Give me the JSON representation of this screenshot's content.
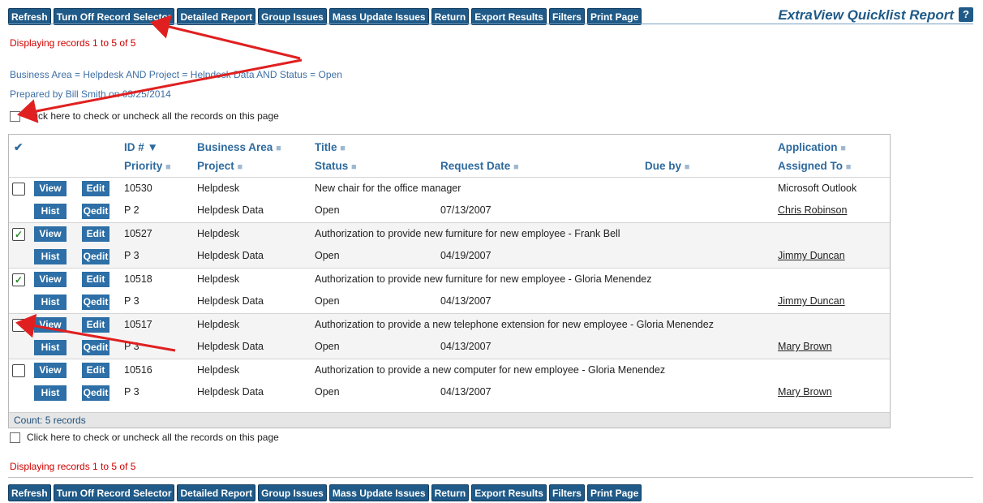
{
  "toolbar": {
    "refresh": "Refresh",
    "turn_off_selector": "Turn Off Record Selector",
    "detailed_report": "Detailed Report",
    "group_issues": "Group Issues",
    "mass_update": "Mass Update Issues",
    "return": "Return",
    "export_results": "Export Results",
    "filters": "Filters",
    "print_page": "Print Page"
  },
  "report_title": "ExtraView Quicklist Report",
  "help_label": "?",
  "displaying_records": "Displaying records 1 to 5 of 5",
  "filter_text": "Business Area = Helpdesk AND Project = Helpdesk Data AND Status = Open",
  "prepared_by": "Prepared by Bill Smith on 03/25/2014",
  "check_all_text": "Click here to check or uncheck all the records on this page",
  "header": {
    "check_mark": "✔",
    "id": "ID #",
    "id_sort": "▼",
    "priority": "Priority",
    "business_area": "Business Area",
    "project": "Project",
    "title": "Title",
    "status": "Status",
    "request_date": "Request Date",
    "due_by": "Due by",
    "application": "Application",
    "assigned_to": "Assigned To",
    "sort_marker": "■"
  },
  "buttons": {
    "view": "View",
    "edit": "Edit",
    "hist": "Hist",
    "qedit": "Qedit"
  },
  "records": [
    {
      "checked": "",
      "id": "10530",
      "priority": "P 2",
      "business_area": "Helpdesk",
      "project": "Helpdesk Data",
      "title": "New chair for the office manager",
      "status": "Open",
      "request_date": "07/13/2007",
      "due_by": "",
      "application": "Microsoft Outlook",
      "assigned_to": "Chris Robinson"
    },
    {
      "checked": "✓",
      "id": "10527",
      "priority": "P 3",
      "business_area": "Helpdesk",
      "project": "Helpdesk Data",
      "title": "Authorization to provide new furniture for new employee - Frank Bell",
      "status": "Open",
      "request_date": "04/19/2007",
      "due_by": "",
      "application": "",
      "assigned_to": "Jimmy Duncan"
    },
    {
      "checked": "✓",
      "id": "10518",
      "priority": "P 3",
      "business_area": "Helpdesk",
      "project": "Helpdesk Data",
      "title": "Authorization to provide new furniture for new employee - Gloria Menendez",
      "status": "Open",
      "request_date": "04/13/2007",
      "due_by": "",
      "application": "",
      "assigned_to": "Jimmy Duncan"
    },
    {
      "checked": "",
      "id": "10517",
      "priority": "P 3",
      "business_area": "Helpdesk",
      "project": "Helpdesk Data",
      "title": "Authorization to provide a new telephone extension for new employee - Gloria Menendez",
      "status": "Open",
      "request_date": "04/13/2007",
      "due_by": "",
      "application": "",
      "assigned_to": "Mary Brown"
    },
    {
      "checked": "",
      "id": "10516",
      "priority": "P 3",
      "business_area": "Helpdesk",
      "project": "Helpdesk Data",
      "title": "Authorization to provide a new computer for new employee - Gloria Menendez",
      "status": "Open",
      "request_date": "04/13/2007",
      "due_by": "",
      "application": "",
      "assigned_to": "Mary Brown"
    }
  ],
  "count_text": "Count: 5 records",
  "colors": {
    "button_bg": "#1f5a88",
    "accent_blue": "#2e6a9e",
    "red": "#d00000",
    "arrow_red": "#e02020"
  }
}
